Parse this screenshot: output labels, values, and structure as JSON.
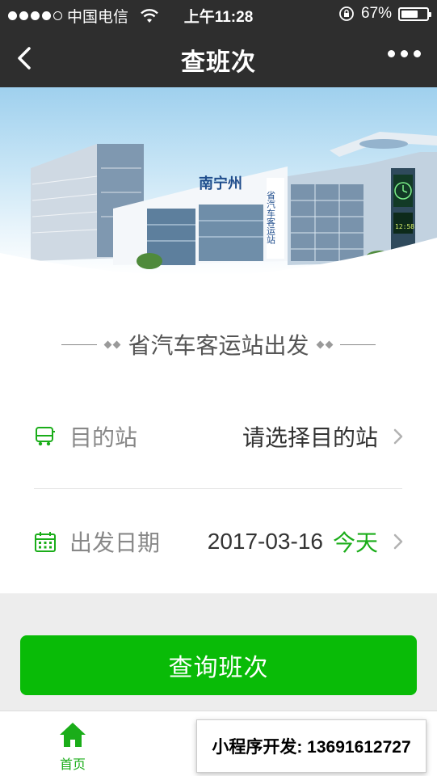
{
  "status_bar": {
    "carrier": "中国电信",
    "time": "上午11:28",
    "battery_percent": "67%",
    "battery_level": 0.67,
    "signal_bars": 4
  },
  "navbar": {
    "title": "查班次",
    "back_icon": "chevron-left-icon",
    "more_icon": "more-dots-icon"
  },
  "banner": {
    "sign_main": "南宁州",
    "sign_vertical": "省汽车客运站",
    "clock_text": "12:58"
  },
  "form": {
    "section_title": "省汽车客运站出发",
    "destination": {
      "label": "目的站",
      "placeholder": "请选择目的站",
      "icon": "bus-icon"
    },
    "date": {
      "label": "出发日期",
      "value": "2017-03-16",
      "today": "今天",
      "icon": "calendar-icon"
    }
  },
  "query_button": {
    "label": "查询班次"
  },
  "tabbar": {
    "home_label": "首页",
    "home_icon": "home-icon"
  },
  "overlay": {
    "dev_label": "小程序开发:  13691612727"
  },
  "colors": {
    "accent_green": "#1aad19",
    "button_green": "#09bb07",
    "nav_bg": "#2e2e2e"
  }
}
